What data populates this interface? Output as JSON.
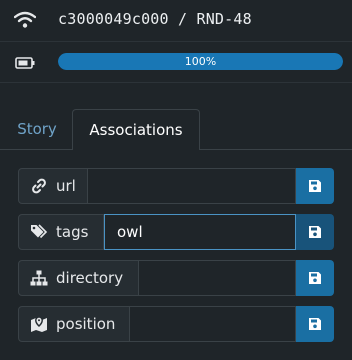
{
  "header": {
    "title": "c3000049c000 / RND-48",
    "wifi_icon": "wifi-icon"
  },
  "battery": {
    "icon": "battery-icon",
    "progress_label": "100%",
    "progress_value": 1.0
  },
  "tabs": [
    {
      "label": "Story",
      "active": false
    },
    {
      "label": "Associations",
      "active": true
    }
  ],
  "fields": [
    {
      "label": "url",
      "icon": "link-icon",
      "value": ""
    },
    {
      "label": "tags",
      "icon": "tags-icon",
      "value": "owl"
    },
    {
      "label": "directory",
      "icon": "sitemap-icon",
      "value": ""
    },
    {
      "label": "position",
      "icon": "map-marker-icon",
      "value": ""
    }
  ],
  "colors": {
    "accent": "#1a6fa3",
    "background": "#1f2529",
    "link": "#6fa3c8"
  }
}
